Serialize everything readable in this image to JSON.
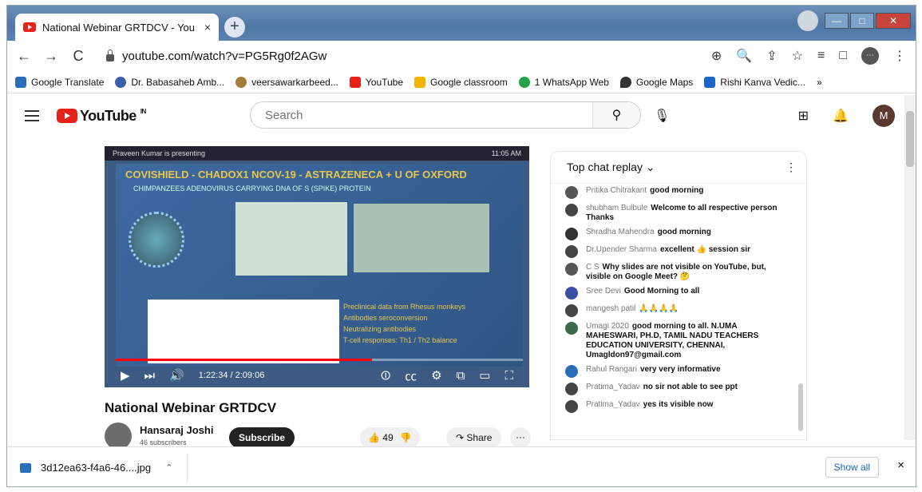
{
  "browser": {
    "tab_title": "National Webinar GRTDCV - You",
    "tab_close": "×",
    "new_tab": "+",
    "url": "youtube.com/watch?v=PG5Rg0f2AGw",
    "nav": {
      "back": "←",
      "forward": "→",
      "reload": "C"
    },
    "toolbar_icons": {
      "install": "⊕",
      "zoom": "🔍",
      "share": "⇪",
      "bookmark": "☆",
      "media": "≡",
      "sidepanel": "□",
      "profile": "⋯",
      "menu": "⋮"
    },
    "window": {
      "minimize": "—",
      "maximize": "□",
      "close": "✕"
    }
  },
  "bookmarks": [
    {
      "label": "Google Translate",
      "color": "#2a6ebb"
    },
    {
      "label": "Dr. Babasaheb Amb...",
      "color": "#3b5fa8"
    },
    {
      "label": "veersawarkarbeed...",
      "color": "#a67c3d"
    },
    {
      "label": "YouTube",
      "color": "#e62117"
    },
    {
      "label": "Google classroom",
      "color": "#f2b400"
    },
    {
      "label": "1 WhatsApp Web",
      "color": "#25a244"
    },
    {
      "label": "Google Maps",
      "color": "#333333"
    },
    {
      "label": "Rishi Kanva Vedic...",
      "color": "#1a66c9"
    },
    {
      "label": "»",
      "color": "#ffffff"
    }
  ],
  "youtube": {
    "logo": "YouTube",
    "country": "IN",
    "search_placeholder": "Search",
    "avatar_letter": "M"
  },
  "video": {
    "presenter_bar": "Praveen Kumar is presenting",
    "clock": "11:05 AM",
    "slide_title": "COVISHIELD - CHADOX1 NCOV-19 - ASTRAZENECA + U OF OXFORD",
    "slide_subtitle": "CHIMPANZEES ADENOVIRUS CARRYING DNA OF S (SPIKE) PROTEIN",
    "bullets": [
      "Preclinical data from Rhesus monkeys",
      "Antibodies seroconversion",
      "Neutralizing antibodies",
      "T-cell responses: Th1 / Th2 balance"
    ],
    "time": "1:22:34 / 2:09:06",
    "progress": 0.63,
    "title": "National Webinar GRTDCV",
    "channel": "Hansaraj Joshi",
    "subscribers": "46 subscribers",
    "subscribe": "Subscribe",
    "likes": "49",
    "share": "Share",
    "more": "···"
  },
  "chat": {
    "header": "Top chat replay",
    "messages": [
      {
        "author": "Pritika Chitrakant",
        "text": "good morning",
        "color": "#555555"
      },
      {
        "author": "shubham Bulbule",
        "text": "Welcome to all respective person Thanks",
        "color": "#444444"
      },
      {
        "author": "Shradha Mahendra",
        "text": "good morning",
        "color": "#333333"
      },
      {
        "author": "Dr.Upender Sharma",
        "text": "excellent 👍 session sir",
        "color": "#444444"
      },
      {
        "author": "C S",
        "text": "Why slides are not visible on YouTube, but, visible on Google Meet? 🤔",
        "color": "#555555"
      },
      {
        "author": "Sree Devi",
        "text": "Good Morning to all",
        "color": "#3a4fa0"
      },
      {
        "author": "mangesh patil",
        "text": "🙏🙏🙏🙏",
        "color": "#444444"
      },
      {
        "author": "Umagi 2020",
        "text": "good morning to all. N.UMA MAHESWARI, PH.D, TAMIL NADU TEACHERS EDUCATION UNIVERSITY, CHENNAI, Umagldon97@gmail.com",
        "color": "#3a6a4a"
      },
      {
        "author": "Rahul Rangari",
        "text": "very very informative",
        "color": "#2a6ebb"
      },
      {
        "author": "Pratima_Yadav",
        "text": "no sir not able to see ppt",
        "color": "#444444"
      },
      {
        "author": "Pratima_Yadav",
        "text": "yes its visible now",
        "color": "#444444"
      }
    ]
  },
  "downloads": {
    "file": "3d12ea63-f4a6-46....jpg",
    "show_all": "Show all",
    "close": "×"
  }
}
